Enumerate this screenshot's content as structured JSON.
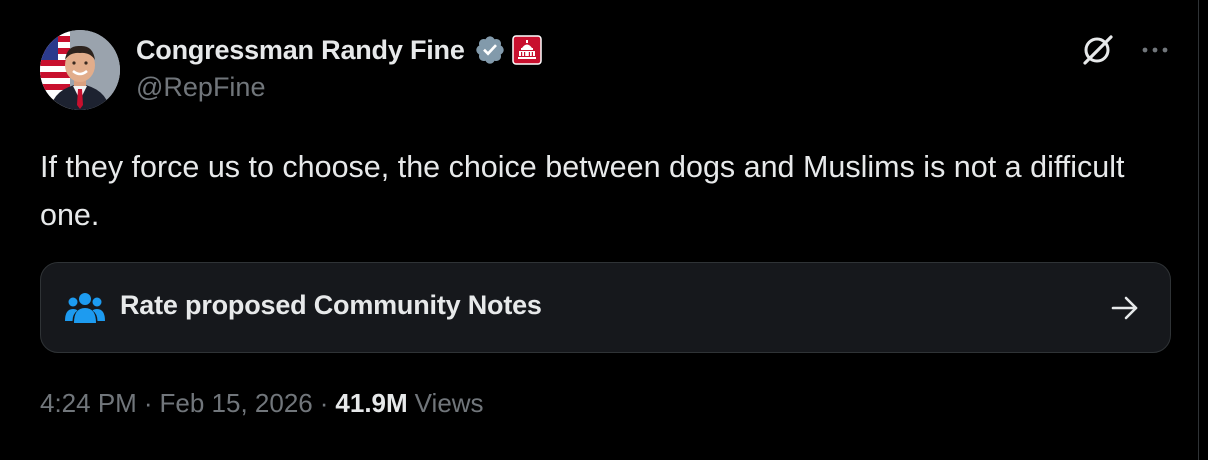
{
  "author": {
    "display_name": "Congressman Randy Fine",
    "handle": "@RepFine",
    "verified": true,
    "verified_color": "#829aab",
    "affiliation_badge": "us-capitol-icon",
    "affiliation_color": "#c8102e"
  },
  "tweet": {
    "text": "If they force us to choose, the choice between dogs and Muslims is not a difficult one."
  },
  "community_notes": {
    "label": "Rate proposed Community Notes",
    "icon": "people-icon",
    "icon_color": "#1d9bf0"
  },
  "meta": {
    "time": "4:24 PM",
    "date": "Feb 15, 2026",
    "separator": "·",
    "views_count": "41.9M",
    "views_label": "Views"
  },
  "header_actions": {
    "grok": "grok-icon",
    "more": "more-icon"
  },
  "colors": {
    "background": "#000000",
    "text_primary": "#e7e9ea",
    "text_secondary": "#71767b",
    "card_background": "#16181c",
    "border": "#2f3336"
  }
}
